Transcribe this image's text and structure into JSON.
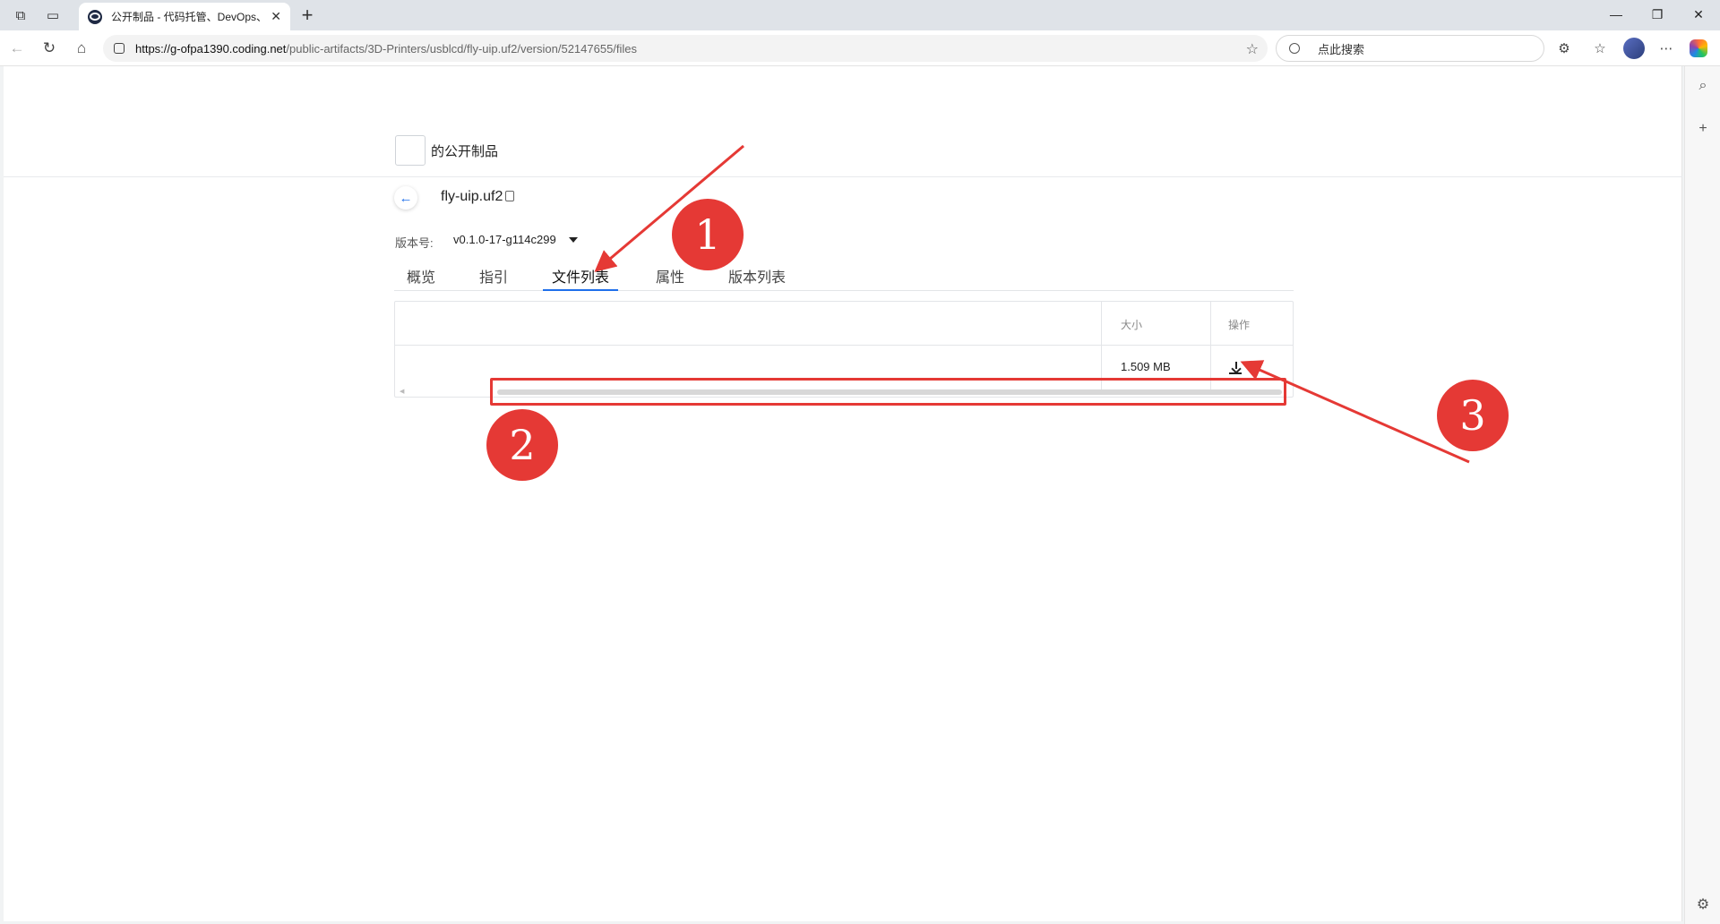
{
  "browser": {
    "tab_title": "公开制品 - 代码托管、DevOps、(",
    "url_host": "https://g-ofpa1390.coding.net",
    "url_path": "/public-artifacts/3D-Printers/usblcd/fly-uip.uf2/version/52147655/files",
    "search_placeholder": "点此搜索"
  },
  "page": {
    "org_name": "的公开制品",
    "package_name": "fly-uip.uf2",
    "version_label": "版本号:",
    "version_value": "v0.1.0-17-g114c299",
    "tabs": [
      {
        "label": "概览"
      },
      {
        "label": "指引"
      },
      {
        "label": "文件列表",
        "active": true
      },
      {
        "label": "属性"
      },
      {
        "label": "版本列表"
      }
    ],
    "table": {
      "headers": {
        "size": "大小",
        "action": "操作"
      },
      "rows": [
        {
          "name": "",
          "size": "1.509 MB",
          "action": "download-icon"
        }
      ]
    }
  },
  "annotations": {
    "badge_1": "1",
    "badge_2": "2",
    "badge_3": "3",
    "color": "#e53935"
  },
  "colors": {
    "accent": "#1f6feb",
    "annotation": "#e53935"
  }
}
